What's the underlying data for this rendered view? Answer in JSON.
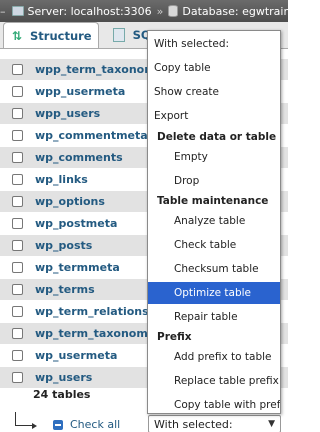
{
  "topbar": {
    "dash": "–",
    "server": "Server: localhost:3306",
    "database": "Database: egwtrainingn"
  },
  "tabs": [
    {
      "label": "Structure",
      "active": true
    },
    {
      "label": "SQL",
      "active": false
    }
  ],
  "tables": [
    "wpp_term_taxonomy",
    "wpp_usermeta",
    "wpp_users",
    "wp_commentmeta",
    "wp_comments",
    "wp_links",
    "wp_options",
    "wp_postmeta",
    "wp_posts",
    "wp_termmeta",
    "wp_terms",
    "wp_term_relationships",
    "wp_term_taxonomy",
    "wp_usermeta",
    "wp_users"
  ],
  "summary": "24 tables",
  "check_all_label": "Check all",
  "with_selected_select": "With selected:",
  "dropdown": {
    "header": "With selected:",
    "copy_table": "Copy table",
    "show_create": "Show create",
    "export": "Export",
    "group_delete": "Delete data or table",
    "empty": "Empty",
    "drop": "Drop",
    "group_maintenance": "Table maintenance",
    "analyze": "Analyze table",
    "check": "Check table",
    "checksum": "Checksum table",
    "optimize": "Optimize table",
    "repair": "Repair table",
    "group_prefix": "Prefix",
    "add_prefix": "Add prefix to table",
    "replace_prefix": "Replace table prefix",
    "copy_with_prefix": "Copy table with prefix",
    "selected_item": "Optimize table"
  },
  "colors": {
    "link": "#235a81",
    "selection": "#2a63cf"
  }
}
